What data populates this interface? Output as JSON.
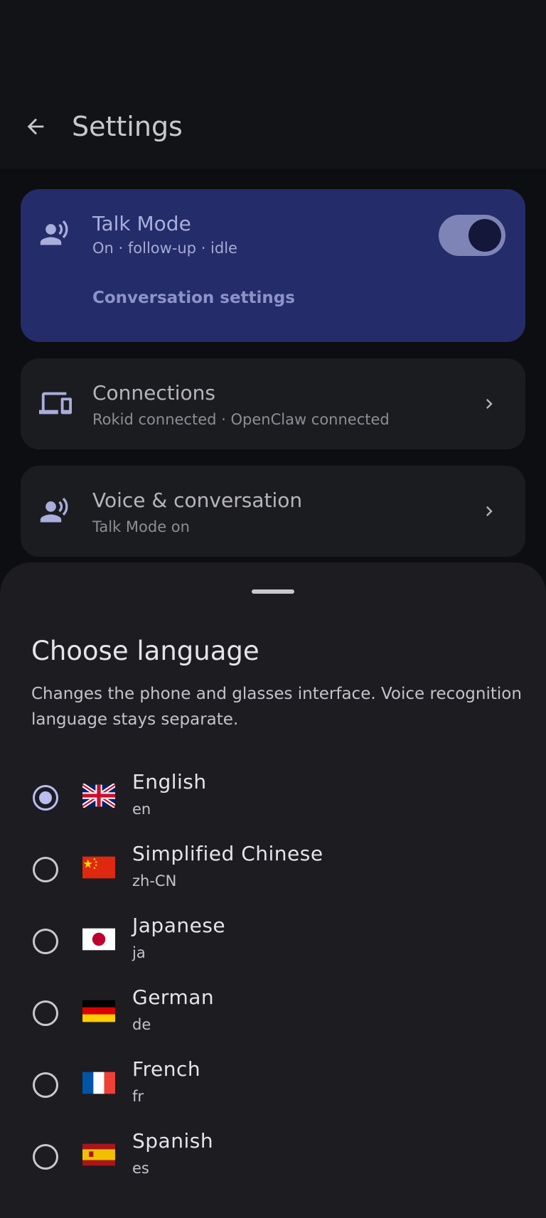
{
  "header": {
    "title": "Settings",
    "back_icon": "arrow-left-icon"
  },
  "talk_card": {
    "title": "Talk Mode",
    "subtitle": "On · follow-up · idle",
    "link": "Conversation settings",
    "toggle_on": true,
    "icon": "voice-person-icon",
    "bg_color": "#242c6a"
  },
  "connections_card": {
    "title": "Connections",
    "subtitle": "Rokid connected · OpenClaw connected",
    "icon": "devices-icon"
  },
  "voice_card": {
    "title": "Voice & conversation",
    "subtitle": "Talk Mode on",
    "icon": "voice-person-icon"
  },
  "sheet": {
    "title": "Choose language",
    "description": "Changes the phone and glasses interface. Voice recognition language stays separate.",
    "languages": [
      {
        "name": "English",
        "code": "en",
        "selected": true,
        "flag": "uk-flag"
      },
      {
        "name": "Simplified Chinese",
        "code": "zh-CN",
        "selected": false,
        "flag": "china-flag"
      },
      {
        "name": "Japanese",
        "code": "ja",
        "selected": false,
        "flag": "japan-flag"
      },
      {
        "name": "German",
        "code": "de",
        "selected": false,
        "flag": "germany-flag"
      },
      {
        "name": "French",
        "code": "fr",
        "selected": false,
        "flag": "france-flag"
      },
      {
        "name": "Spanish",
        "code": "es",
        "selected": false,
        "flag": "spain-flag"
      }
    ]
  },
  "colors": {
    "accent": "#b9bdf2",
    "sheet_bg": "#1d1c21",
    "page_bg": "#0d0e11"
  }
}
